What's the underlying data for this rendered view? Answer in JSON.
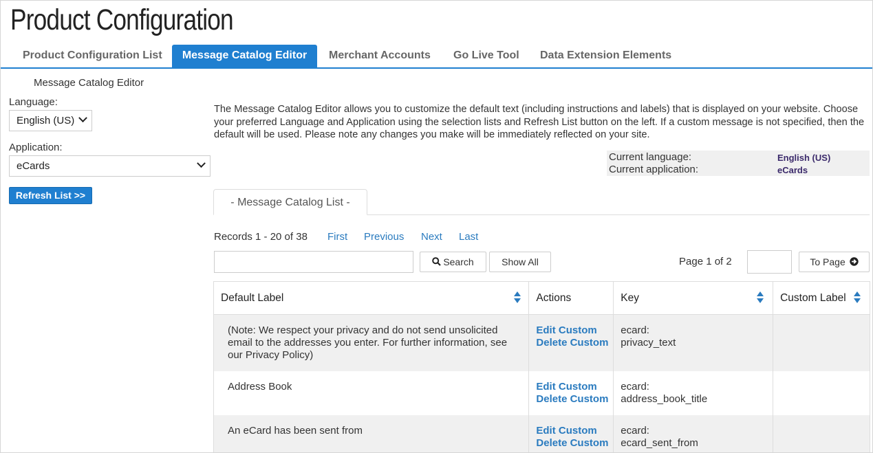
{
  "page": {
    "title": "Product Configuration"
  },
  "tabs": [
    {
      "label": "Product Configuration List"
    },
    {
      "label": "Message Catalog Editor"
    },
    {
      "label": "Merchant Accounts"
    },
    {
      "label": "Go Live Tool"
    },
    {
      "label": "Data Extension Elements"
    }
  ],
  "sidebar": {
    "title": "Message Catalog Editor",
    "language_label": "Language:",
    "language_value": "English (US)",
    "application_label": "Application:",
    "application_value": "eCards",
    "refresh_label": "Refresh List >>"
  },
  "intro": "The Message Catalog Editor allows you to customize the default text (including instructions and labels) that is displayed on your website. Choose your preferred Language and Application using the selection lists and Refresh List button on the left. If a custom message is not specified, then the default will be used. Please note any changes you make will be immediately reflected on your site.",
  "current": {
    "language_label": "Current language:",
    "language_value": "English (US)",
    "application_label": "Current application:",
    "application_value": "eCards"
  },
  "subtab": {
    "label": "- Message Catalog List -"
  },
  "pager": {
    "records": "Records 1 - 20 of 38",
    "first": "First",
    "previous": "Previous",
    "next": "Next",
    "last": "Last",
    "search_label": "Search",
    "show_all_label": "Show All",
    "page_of": "Page 1 of 2",
    "to_page_label": "To Page"
  },
  "table": {
    "headers": {
      "default_label": "Default Label",
      "actions": "Actions",
      "key": "Key",
      "custom_label": "Custom Label"
    },
    "edit_label": "Edit Custom",
    "delete_label": "Delete Custom",
    "rows": [
      {
        "default_label": "(Note: We respect your privacy and do not send unsolicited email to the addresses you enter. For further information, see our Privacy Policy)",
        "key_prefix": "ecard:",
        "key_name": "privacy_text",
        "custom_label": ""
      },
      {
        "default_label": "Address Book",
        "key_prefix": "ecard:",
        "key_name": "address_book_title",
        "custom_label": ""
      },
      {
        "default_label": "An eCard has been sent from",
        "key_prefix": "ecard:",
        "key_name": "ecard_sent_from",
        "custom_label": ""
      }
    ]
  }
}
